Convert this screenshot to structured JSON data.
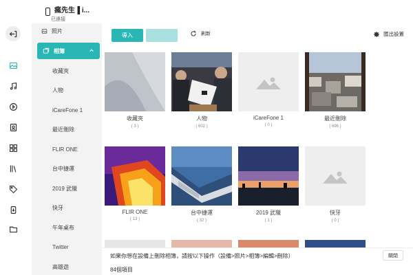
{
  "device": {
    "name": "瘋先生▐ i...",
    "status": "已連接"
  },
  "sidebar": {
    "photos_label": "照片",
    "albums_label": "相簿",
    "albums": [
      "收藏夾",
      "人物",
      "iCareFone 1",
      "最近刪除",
      "FLIR ONE",
      "台中捷運",
      "2019 武獵",
      "快牙",
      "午年桌布",
      "Twitter",
      "高雄遊"
    ]
  },
  "toolbar": {
    "import_label": "導入",
    "export_label": "",
    "refresh_label": "刷新",
    "settings_label": "匯出設置"
  },
  "grid": [
    {
      "name": "收藏夾",
      "count": "( 3 )",
      "thumb": "ipad"
    },
    {
      "name": "人物",
      "count": "( 602 )",
      "thumb": "crowd"
    },
    {
      "name": "iCareFone 1",
      "count": "( 0 )",
      "thumb": "placeholder"
    },
    {
      "name": "最近刪除",
      "count": "( 696 )",
      "thumb": "city"
    },
    {
      "name": "FLIR ONE",
      "count": "( 13 )",
      "thumb": "thermal"
    },
    {
      "name": "台中捷運",
      "count": "( 32 )",
      "thumb": "building"
    },
    {
      "name": "2019 武獵",
      "count": "( 1 )",
      "thumb": "sunset"
    },
    {
      "name": "快牙",
      "count": "( 0 )",
      "thumb": "placeholder"
    }
  ],
  "bottom": {
    "hint": "如果你想在設備上刪除相簿，請按以下操作（設備>照片>相簿>編輯>刪除）",
    "close_label": "關閉",
    "item_count": "84個項目"
  },
  "colors": {
    "accent": "#2bb6b6",
    "accent_light": "#a8e0e0",
    "sidebar_bg": "#f3f3f3"
  }
}
